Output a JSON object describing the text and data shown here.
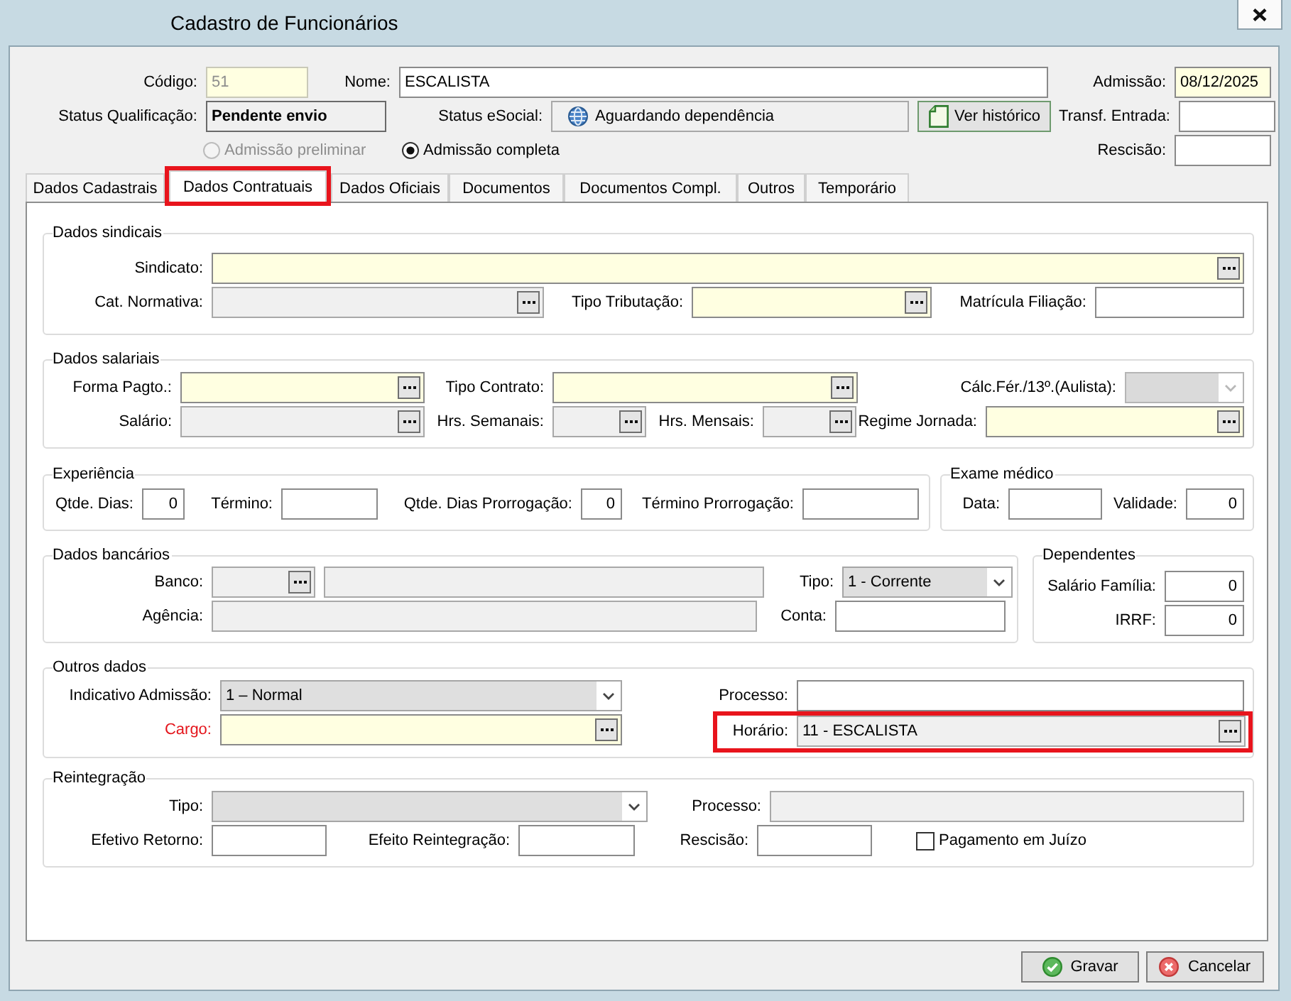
{
  "window": {
    "title": "Cadastro de Funcionários"
  },
  "header": {
    "lines": [
      {
        "fields": [
          {
            "kind": "text",
            "label": "Código:",
            "value": "51",
            "required": true,
            "readonly": false,
            "disabled": true
          },
          {
            "kind": "text",
            "label": "Nome:",
            "value": "ESCALISTA",
            "required": false,
            "readonly": false,
            "disabled": false
          },
          {
            "kind": "text",
            "label": "Admissão:",
            "value": "08/12/2025",
            "required": true,
            "readonly": false,
            "disabled": false
          }
        ]
      },
      {
        "fields": [
          {
            "kind": "status",
            "label": "Status Qualificação:",
            "value": "Pendente envio"
          },
          {
            "kind": "status_icon",
            "label": "Status eSocial:",
            "value": "Aguardando dependência"
          },
          {
            "kind": "button",
            "label": "Ver histórico"
          },
          {
            "kind": "text",
            "label": "Transf. Entrada:",
            "required": false,
            "readonly": false,
            "disabled": false
          }
        ]
      },
      {
        "fields": [
          {
            "kind": "radio",
            "label": "Admissão preliminar",
            "selected": false,
            "disabled": true
          },
          {
            "kind": "radio",
            "label": "Admissão completa",
            "selected": true,
            "disabled": false
          },
          {
            "kind": "text",
            "label": "Rescisão:",
            "required": false,
            "readonly": false,
            "disabled": false
          }
        ]
      }
    ]
  },
  "tabs": [
    {
      "label": "Dados Cadastrais",
      "selected": false,
      "highlighted": false
    },
    {
      "label": "Dados Contratuais",
      "selected": true,
      "highlighted": true
    },
    {
      "label": "Dados Oficiais",
      "selected": false,
      "highlighted": false
    },
    {
      "label": "Documentos",
      "selected": false,
      "highlighted": false
    },
    {
      "label": "Documentos Compl.",
      "selected": false,
      "highlighted": false
    },
    {
      "label": "Outros",
      "selected": false,
      "highlighted": false
    },
    {
      "label": "Temporário",
      "selected": false,
      "highlighted": false
    }
  ],
  "groups": [
    {
      "title": "Dados sindicais",
      "lines": [
        {
          "fields": [
            {
              "kind": "lookup",
              "label": "Sindicato:",
              "required": true,
              "readonly": false
            }
          ]
        },
        {
          "fields": [
            {
              "kind": "lookup",
              "label": "Cat. Normativa:",
              "required": false,
              "readonly": true
            },
            {
              "kind": "lookup",
              "label": "Tipo Tributação:",
              "required": true,
              "readonly": false
            },
            {
              "kind": "text",
              "label": "Matrícula Filiação:",
              "required": false,
              "readonly": false
            }
          ]
        }
      ]
    },
    {
      "title": "Dados salariais",
      "lines": [
        {
          "fields": [
            {
              "kind": "lookup",
              "label": "Forma Pagto.:",
              "required": true,
              "readonly": false
            },
            {
              "kind": "lookup",
              "label": "Tipo Contrato:",
              "required": true,
              "readonly": false
            },
            {
              "kind": "select",
              "label": "Cálc.Fér./13º.(Aulista):",
              "disabled": true
            }
          ]
        },
        {
          "fields": [
            {
              "kind": "lookup",
              "label": "Salário:",
              "required": false,
              "readonly": true
            },
            {
              "kind": "lookup",
              "label": "Hrs. Semanais:",
              "required": false,
              "readonly": true
            },
            {
              "kind": "lookup",
              "label": "Hrs. Mensais:",
              "required": false,
              "readonly": true
            },
            {
              "kind": "lookup",
              "label": "Regime Jornada:",
              "required": true,
              "readonly": false
            }
          ]
        }
      ]
    },
    {
      "title": "Experiência",
      "lines": [
        {
          "fields": [
            {
              "kind": "number",
              "label": "Qtde. Dias:",
              "value": "0",
              "required": false,
              "readonly": false
            },
            {
              "kind": "text",
              "label": "Término:",
              "required": false,
              "readonly": false
            },
            {
              "kind": "number",
              "label": "Qtde. Dias Prorrogação:",
              "value": "0",
              "required": false,
              "readonly": false
            },
            {
              "kind": "text",
              "label": "Término Prorrogação:",
              "required": false,
              "readonly": false
            }
          ]
        }
      ]
    },
    {
      "title": "Exame médico",
      "lines": [
        {
          "fields": [
            {
              "kind": "text",
              "label": "Data:",
              "required": false,
              "readonly": false
            },
            {
              "kind": "number",
              "label": "Validade:",
              "value": "0",
              "required": false,
              "readonly": false
            }
          ]
        }
      ]
    },
    {
      "title": "Dados bancários",
      "lines": [
        {
          "fields": [
            {
              "kind": "lookup",
              "label": "Banco:",
              "required": false,
              "readonly": true
            },
            {
              "kind": "text",
              "required": false,
              "readonly": true
            },
            {
              "kind": "select",
              "label": "Tipo:",
              "value": "1 - Corrente",
              "disabled": false
            }
          ]
        },
        {
          "fields": [
            {
              "kind": "text",
              "label": "Agência:",
              "required": false,
              "readonly": true
            },
            {
              "kind": "text",
              "label": "Conta:",
              "required": false,
              "readonly": false
            }
          ]
        }
      ]
    },
    {
      "title": "Dependentes",
      "lines": [
        {
          "fields": [
            {
              "kind": "number",
              "label": "Salário Família:",
              "value": "0",
              "required": false,
              "readonly": false
            }
          ]
        },
        {
          "fields": [
            {
              "kind": "number",
              "label": "IRRF:",
              "value": "0",
              "required": false,
              "readonly": false
            }
          ]
        }
      ]
    },
    {
      "title": "Outros dados",
      "lines": [
        {
          "fields": [
            {
              "kind": "select",
              "label": "Indicativo Admissão:",
              "value": "1 – Normal",
              "disabled": false,
              "alert": false,
              "highlighted": false
            },
            {
              "kind": "text",
              "label": "Processo:",
              "required": false,
              "readonly": false,
              "alert": false,
              "highlighted": false
            }
          ]
        },
        {
          "fields": [
            {
              "kind": "lookup",
              "label": "Cargo:",
              "required": true,
              "readonly": false,
              "alert": true,
              "highlighted": false
            },
            {
              "kind": "lookup",
              "label": "Horário:",
              "value": "11 - ESCALISTA",
              "required": false,
              "readonly": true,
              "alert": false,
              "highlighted": true
            }
          ]
        }
      ]
    },
    {
      "title": "Reintegração",
      "lines": [
        {
          "fields": [
            {
              "kind": "select",
              "label": "Tipo:",
              "disabled": false
            },
            {
              "kind": "text",
              "label": "Processo:",
              "required": false,
              "readonly": true
            }
          ]
        },
        {
          "fields": [
            {
              "kind": "text",
              "label": "Efetivo Retorno:",
              "required": false,
              "readonly": false
            },
            {
              "kind": "text",
              "label": "Efeito Reintegração:",
              "required": false,
              "readonly": false
            },
            {
              "kind": "text",
              "label": "Rescisão:",
              "required": false,
              "readonly": false
            },
            {
              "kind": "checkbox",
              "label": "Pagamento em Juízo",
              "checked": false
            }
          ]
        }
      ]
    }
  ],
  "buttons": [
    {
      "kind": "save",
      "label": "Gravar"
    },
    {
      "kind": "cancel",
      "label": "Cancelar"
    }
  ]
}
